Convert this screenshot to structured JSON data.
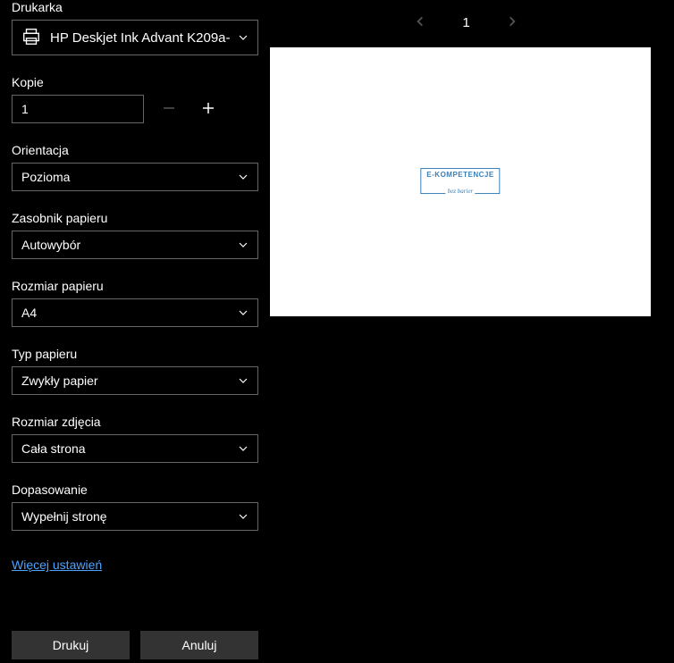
{
  "printer": {
    "label": "Drukarka",
    "value": "HP Deskjet Ink Advant K209a-"
  },
  "copies": {
    "label": "Kopie",
    "value": "1"
  },
  "orientation": {
    "label": "Orientacja",
    "value": "Pozioma"
  },
  "paperTray": {
    "label": "Zasobnik papieru",
    "value": "Autowybór"
  },
  "paperSize": {
    "label": "Rozmiar papieru",
    "value": "A4"
  },
  "paperType": {
    "label": "Typ papieru",
    "value": "Zwykły papier"
  },
  "photoSize": {
    "label": "Rozmiar zdjęcia",
    "value": "Cała strona"
  },
  "fit": {
    "label": "Dopasowanie",
    "value": "Wypełnij stronę"
  },
  "moreSettings": "Więcej ustawień",
  "buttons": {
    "print": "Drukuj",
    "cancel": "Anuluj"
  },
  "pager": {
    "current": "1"
  },
  "previewLogo": {
    "line1": "E-KOMPETENCJE",
    "line2": "bez barier"
  }
}
